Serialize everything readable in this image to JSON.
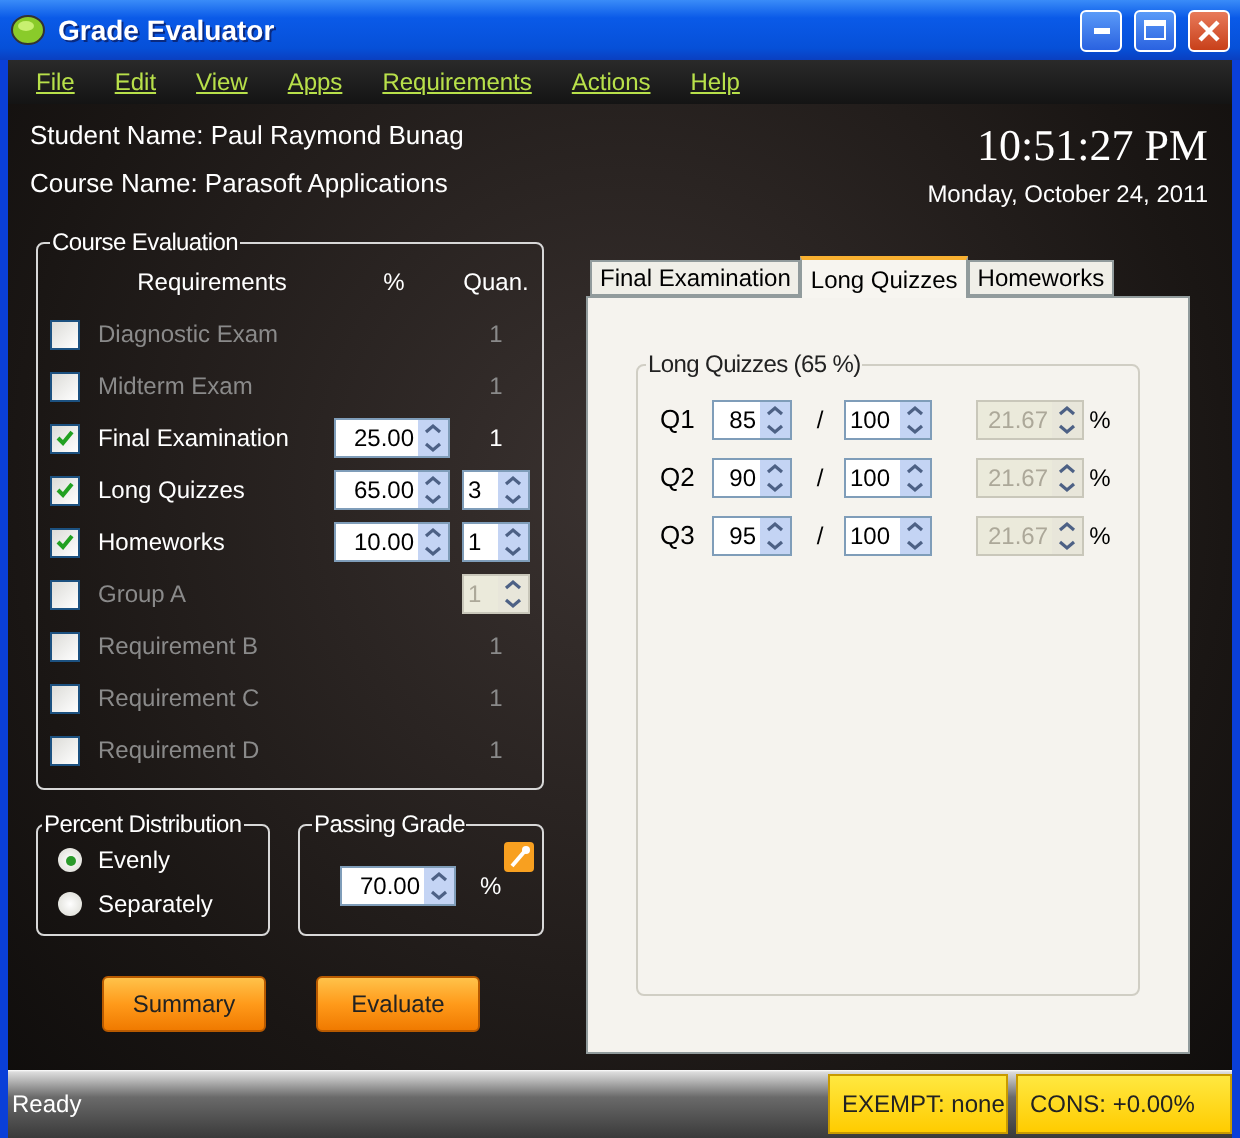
{
  "window": {
    "title": "Grade Evaluator"
  },
  "menu": [
    "File",
    "Edit",
    "View",
    "Apps",
    "Requirements",
    "Actions",
    "Help"
  ],
  "header": {
    "student": "Student Name: Paul Raymond Bunag",
    "course": "Course Name: Parasoft Applications",
    "time": "10:51:27 PM",
    "date": "Monday, October 24, 2011"
  },
  "course_evaluation": {
    "title": "Course Evaluation",
    "columns": [
      "Requirements",
      "%",
      "Quan."
    ],
    "requirements": [
      {
        "label": "Diagnostic Exam",
        "checked": false,
        "quantity": {
          "kind": "text",
          "value": "1"
        }
      },
      {
        "label": "Midterm Exam",
        "checked": false,
        "quantity": {
          "kind": "text",
          "value": "1"
        }
      },
      {
        "label": "Final Examination",
        "checked": true,
        "percent": "25.00",
        "quantity": {
          "kind": "text",
          "value": "1"
        }
      },
      {
        "label": "Long Quizzes",
        "checked": true,
        "percent": "65.00",
        "quantity": {
          "kind": "spin",
          "value": "3",
          "disabled": false
        }
      },
      {
        "label": "Homeworks",
        "checked": true,
        "percent": "10.00",
        "quantity": {
          "kind": "spin",
          "value": "1",
          "disabled": false
        }
      },
      {
        "label": "Group A",
        "checked": false,
        "quantity": {
          "kind": "spin",
          "value": "1",
          "disabled": true
        }
      },
      {
        "label": "Requirement B",
        "checked": false,
        "quantity": {
          "kind": "text",
          "value": "1"
        }
      },
      {
        "label": "Requirement C",
        "checked": false,
        "quantity": {
          "kind": "text",
          "value": "1"
        }
      },
      {
        "label": "Requirement D",
        "checked": false,
        "quantity": {
          "kind": "text",
          "value": "1"
        }
      }
    ]
  },
  "percent_distribution": {
    "title": "Percent Distribution",
    "options": [
      {
        "label": "Evenly",
        "selected": true
      },
      {
        "label": "Separately",
        "selected": false
      }
    ]
  },
  "passing_grade": {
    "title": "Passing Grade",
    "value": "70.00",
    "unit": "%"
  },
  "buttons": [
    "Summary",
    "Evaluate"
  ],
  "tabs": [
    {
      "label": "Final Examination",
      "selected": false
    },
    {
      "label": "Long Quizzes",
      "selected": true
    },
    {
      "label": "Homeworks",
      "selected": false
    }
  ],
  "quiz_group": {
    "title": "Long Quizzes (65 %)",
    "separator": "/",
    "unit": "%",
    "rows": [
      {
        "label": "Q1",
        "score": "85",
        "max": "100",
        "weighted": "21.67"
      },
      {
        "label": "Q2",
        "score": "90",
        "max": "100",
        "weighted": "21.67"
      },
      {
        "label": "Q3",
        "score": "95",
        "max": "100",
        "weighted": "21.67"
      }
    ]
  },
  "status_bar": {
    "text": "Ready",
    "panels": [
      "EXEMPT: none",
      "CONS: +0.00%"
    ]
  }
}
